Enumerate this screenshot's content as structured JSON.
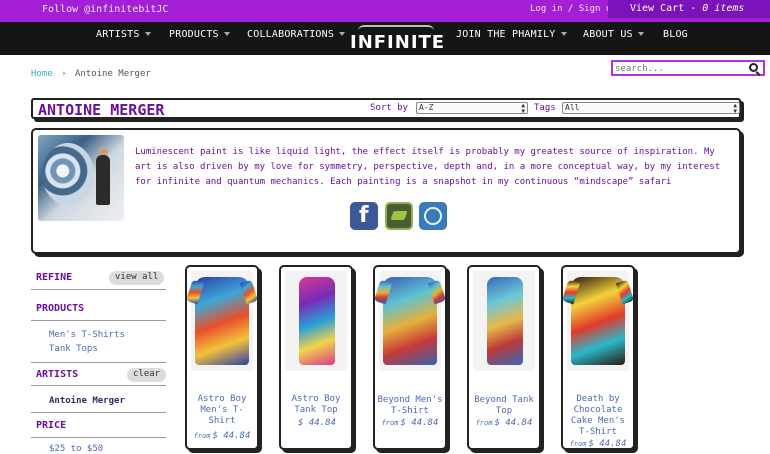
{
  "topbar": {
    "follow": "Follow @infinitebitJC",
    "login": "Log in / Sign up",
    "cart_prefix": "View Cart -",
    "cart_items": "0 items"
  },
  "nav": {
    "items": [
      "ARTISTS",
      "PRODUCTS",
      "COLLABORATIONS",
      "JOIN THE PHAMILY",
      "ABOUT US",
      "BLOG"
    ],
    "logo_text": "INFINITE"
  },
  "breadcrumb": {
    "home": "Home",
    "separator": "›",
    "current": "Antoine Merger"
  },
  "search": {
    "placeholder": "search..."
  },
  "titlebar": {
    "title": "ANTOINE MERGER",
    "sort_label": "Sort by",
    "sort_value": "A-Z",
    "tags_label": "Tags",
    "tags_value": "All"
  },
  "bio": {
    "text": "Luminescent paint is like liquid light, the effect itself is probably my greatest source of inspiration. My art is also driven by my love for symmetry, perspective, depth and, in a more conceptual way, by my interest for infinite and quantum mechanics. Each painting is a snapshot in my continuous “mindscape” safari",
    "social_icons": [
      "facebook-icon",
      "deviantart-icon",
      "website-icon"
    ]
  },
  "sidebar": {
    "refine": "REFINE",
    "view_all": "view all",
    "products_heading": "PRODUCTS",
    "product_links": [
      "Men's T-Shirts",
      "Tank Tops"
    ],
    "artists_heading": "ARTISTS",
    "clear": "clear",
    "active_artist": "Antoine Merger",
    "price_heading": "PRICE",
    "price_partial": "$25 to $50"
  },
  "products": [
    {
      "name": "Astro Boy Men's T-Shirt",
      "from": "from",
      "price": "$ 44.84",
      "colors": [
        "#2b3ea8",
        "#e84f2a",
        "#f2c23a",
        "#3fa7d6"
      ]
    },
    {
      "name": "Astro Boy Tank Top",
      "from": "",
      "price": "$ 44.84",
      "colors": [
        "#d83a8a",
        "#2a9fd8",
        "#f1d34a",
        "#7a2ab8"
      ]
    },
    {
      "name": "Beyond Men's T-Shirt",
      "from": "from",
      "price": "$ 44.84",
      "colors": [
        "#3a5fb0",
        "#e5b03a",
        "#c43a3a",
        "#5fc2d4"
      ]
    },
    {
      "name": "Beyond Tank Top",
      "from": "from",
      "price": "$ 44.84",
      "colors": [
        "#3a66b8",
        "#e8b84a",
        "#b83a3a",
        "#6ac8d8"
      ]
    },
    {
      "name": "Death by Chocolate Cake Men's T-Shirt",
      "from": "from",
      "price": "$ 44.84",
      "colors": [
        "#2b1a10",
        "#e23a2a",
        "#2ab8c8",
        "#f2d23a"
      ]
    }
  ]
}
